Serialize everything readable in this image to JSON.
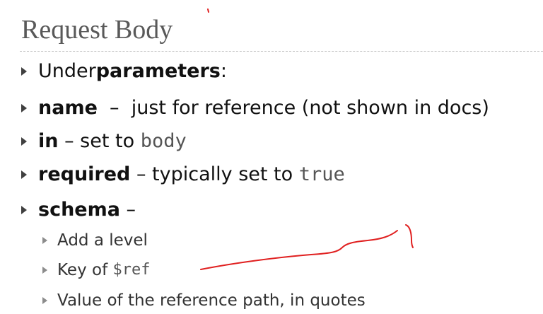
{
  "slide": {
    "title": "Request Body",
    "bullets": [
      {
        "bold": "",
        "text": "Under ",
        "bold_after": "parameters",
        "after": ":"
      },
      {
        "bold": "name",
        "text": "  –  just for reference (not shown in docs)"
      },
      {
        "bold": "in",
        "text": " – set to ",
        "code": "body"
      },
      {
        "bold": "required",
        "text": " – typically set to ",
        "code": "true"
      },
      {
        "bold": "schema",
        "text": " –"
      }
    ],
    "sub_bullets": [
      {
        "text": "Add a level"
      },
      {
        "text": "Key of ",
        "code": "$ref"
      },
      {
        "text": "Value of the reference path, in quotes"
      }
    ]
  },
  "colors": {
    "title": "#595959",
    "body_text": "#111111",
    "code_text": "#555555",
    "annotation_ink": "#e02020"
  }
}
